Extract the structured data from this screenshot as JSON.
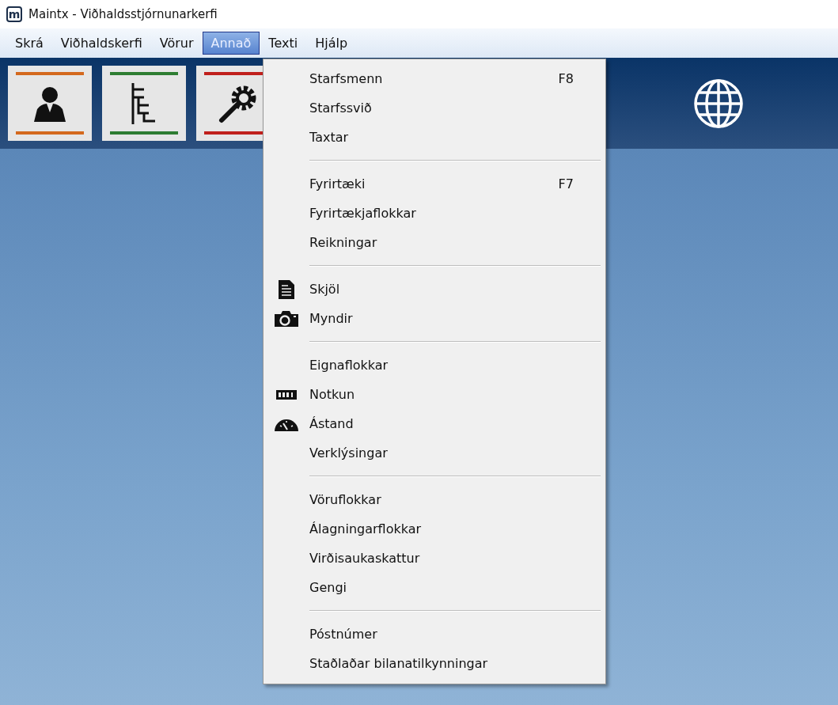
{
  "window": {
    "title": "Maintx - Viðhaldsstjórnunarkerfi",
    "app_icon_letter": "m"
  },
  "menu_bar": [
    {
      "label": "Skrá",
      "selected": false
    },
    {
      "label": "Viðhaldskerfi",
      "selected": false
    },
    {
      "label": "Vörur",
      "selected": false
    },
    {
      "label": "Annað",
      "selected": true
    },
    {
      "label": "Texti",
      "selected": false
    },
    {
      "label": "Hjálp",
      "selected": false
    }
  ],
  "toolbar": [
    {
      "kind": "person",
      "color": "#d4691e"
    },
    {
      "kind": "tree",
      "color": "#2e7d32"
    },
    {
      "kind": "tools",
      "color": "#c0201c"
    }
  ],
  "dropdown_groups": [
    [
      {
        "label": "Starfsmenn",
        "shortcut": "F8",
        "kind": "plain"
      },
      {
        "label": "Starfssvið",
        "kind": "plain"
      },
      {
        "label": "Taxtar",
        "kind": "plain"
      }
    ],
    [
      {
        "label": "Fyrirtæki",
        "shortcut": "F7",
        "kind": "plain"
      },
      {
        "label": "Fyrirtækjaflokkar",
        "kind": "plain"
      },
      {
        "label": "Reikningar",
        "kind": "plain"
      }
    ],
    [
      {
        "label": "Skjöl",
        "kind": "document"
      },
      {
        "label": "Myndir",
        "kind": "camera"
      }
    ],
    [
      {
        "label": "Eignaflokkar",
        "kind": "plain"
      },
      {
        "label": "Notkun",
        "kind": "counter"
      },
      {
        "label": "Ástand",
        "kind": "gauge"
      },
      {
        "label": "Verklýsingar",
        "kind": "plain"
      }
    ],
    [
      {
        "label": "Vöruflokkar",
        "kind": "plain"
      },
      {
        "label": "Álagningarflokkar",
        "kind": "plain"
      },
      {
        "label": "Virðisaukaskattur",
        "kind": "plain"
      },
      {
        "label": "Gengi",
        "kind": "plain"
      }
    ],
    [
      {
        "label": "Póstnúmer",
        "kind": "plain"
      },
      {
        "label": "Staðlaðar bilanatilkynningar",
        "kind": "plain"
      }
    ]
  ]
}
